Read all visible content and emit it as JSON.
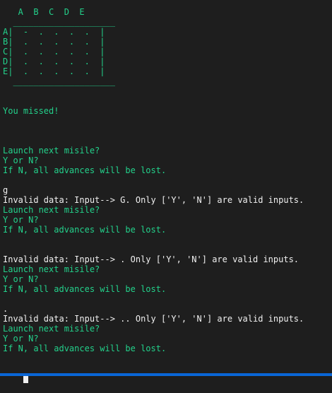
{
  "theme": {
    "background": "#1e1e1e",
    "accent": "#23d18b",
    "foreground": "#f0f0f0",
    "bottom_bar": "#0a66d6"
  },
  "board": {
    "header": "   A  B  C  D  E",
    "top_border": "  ____________________",
    "rows": [
      "A|  -  .  .  .  .  |",
      "B|  .  .  .  .  .  |",
      "C|  .  .  .  .  .  |",
      "D|  .  .  .  .  .  |",
      "E|  .  .  .  .  .  |"
    ],
    "bottom_border": "  ____________________"
  },
  "output": {
    "missed": "You missed!",
    "prompt_launch": "Launch next misile?",
    "prompt_yn": "Y or N?",
    "prompt_warning": "If N, all advances will be lost."
  },
  "inputs": {
    "first": "g",
    "second": "",
    "third": "."
  },
  "errors": {
    "first": "Invalid data: Input--> G. Only ['Y', 'N'] are valid inputs.",
    "second": "Invalid data: Input--> . Only ['Y', 'N'] are valid inputs.",
    "third": "Invalid data: Input--> .. Only ['Y', 'N'] are valid inputs."
  }
}
